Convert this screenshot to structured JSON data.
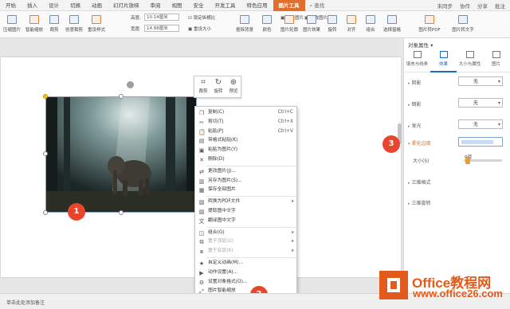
{
  "menubar": {
    "tabs": [
      "开始",
      "插入",
      "设计",
      "切换",
      "动画",
      "幻灯片放映",
      "审阅",
      "视图",
      "安全",
      "开发工具",
      "特色应用",
      "图片工具"
    ],
    "active_tab": "图片工具",
    "search": "查找",
    "right_items": [
      "未同步",
      "协作",
      "分享",
      "批注"
    ]
  },
  "ribbon": {
    "buttons": [
      "压缩图片",
      "智能缩放",
      "裁剪",
      "创意裁剪",
      "重设样式",
      "抠除背景",
      "颜色",
      "图片轮廓",
      "图片效果",
      "旋转",
      "对齐",
      "组合",
      "选择窗格",
      "图片转PDF",
      "图片转文字"
    ],
    "height_label": "高度:",
    "height_value": "10.14厘米",
    "width_label": "宽度:",
    "width_value": "14.88厘米",
    "lock_ratio": "锁定纵横比",
    "reset_size": "重设大小",
    "reset_pic": "重设图片",
    "change_pic": "更改图片"
  },
  "mini_toolbar": {
    "crop": "裁剪",
    "rotate": "旋转",
    "preview": "预览"
  },
  "context_menu": {
    "items": [
      {
        "icon": "copy-icon",
        "label": "复制(C)",
        "shortcut": "Ctrl+C",
        "disabled": false
      },
      {
        "icon": "cut-icon",
        "label": "剪切(T)",
        "shortcut": "Ctrl+X",
        "disabled": false
      },
      {
        "icon": "paste-icon",
        "label": "粘贴(P)",
        "shortcut": "Ctrl+V",
        "disabled": false
      },
      {
        "icon": "paste-special-icon",
        "label": "带格式粘贴(K)",
        "shortcut": "",
        "disabled": false
      },
      {
        "icon": "paste-image-icon",
        "label": "粘贴为图片(Y)",
        "shortcut": "",
        "disabled": false
      },
      {
        "icon": "delete-icon",
        "label": "删除(D)",
        "shortcut": "",
        "disabled": false
      },
      {
        "icon": "change-image-icon",
        "label": "更改图片(J)...",
        "shortcut": "",
        "disabled": false
      },
      {
        "icon": "save-image-icon",
        "label": "另存为图片(S)...",
        "shortcut": "",
        "disabled": false
      },
      {
        "icon": "save-all-icon",
        "label": "保存全部图片",
        "shortcut": "",
        "disabled": false
      },
      {
        "icon": "pdf-icon",
        "label": "转换为PDF文件",
        "shortcut": "",
        "disabled": false
      },
      {
        "icon": "ocr-icon",
        "label": "提取图中文字",
        "shortcut": "",
        "disabled": false
      },
      {
        "icon": "translate-icon",
        "label": "翻译图中文字",
        "shortcut": "",
        "disabled": false
      },
      {
        "icon": "group-icon",
        "label": "组合(G)",
        "shortcut": "",
        "disabled": false
      },
      {
        "icon": "bring-front-icon",
        "label": "置于顶层(U)",
        "shortcut": "",
        "disabled": true
      },
      {
        "icon": "send-back-icon",
        "label": "置于底层(K)",
        "shortcut": "",
        "disabled": true
      },
      {
        "icon": "animation-icon",
        "label": "自定义动画(M)...",
        "shortcut": "",
        "disabled": false
      },
      {
        "icon": "action-icon",
        "label": "动作设置(A)...",
        "shortcut": "",
        "disabled": false
      },
      {
        "icon": "format-icon",
        "label": "设置对象格式(O)...",
        "shortcut": "",
        "disabled": false
      },
      {
        "icon": "smart-scale-icon",
        "label": "图片智能缩放",
        "shortcut": "",
        "disabled": false
      }
    ]
  },
  "badges": {
    "b1": "1",
    "b2": "2",
    "b3": "3"
  },
  "panel": {
    "title": "对象属性 ▾",
    "tabs": [
      "填充与线条",
      "效果",
      "大小与属性",
      "图片"
    ],
    "active_tab": "效果",
    "sections": {
      "shadow": "阴影",
      "reflection": "倒影",
      "glow": "发光",
      "soft_edges": "柔化边缘",
      "size": "大小(S)",
      "size_value": "0磅",
      "three_d_format": "三维格式",
      "three_d_rotation": "三维旋转"
    },
    "dropdown_value": "无"
  },
  "status": {
    "text": "单击此处添加备注"
  },
  "logo": {
    "line1": "Office教程网",
    "line2": "www.office26.com"
  },
  "colors": {
    "accent": "#e06e2c",
    "badge": "#e8452c",
    "blue": "#1b6ac9"
  }
}
